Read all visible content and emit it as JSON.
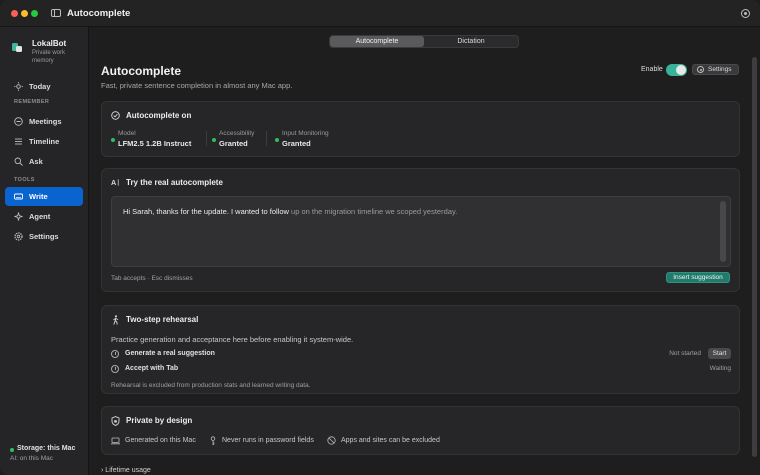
{
  "window": {
    "title": "Autocomplete"
  },
  "sidebar": {
    "brand_name": "LokalBot",
    "brand_tagline": "Private work memory",
    "section_remember": "REMEMBER",
    "section_tools": "TOOLS",
    "items": [
      {
        "label": "Today",
        "icon": "sun-icon"
      },
      {
        "label": "Meetings",
        "icon": "waveform-icon"
      },
      {
        "label": "Timeline",
        "icon": "list-icon"
      },
      {
        "label": "Ask",
        "icon": "magnifier-icon"
      },
      {
        "label": "Write",
        "icon": "keyboard-icon",
        "active": true
      },
      {
        "label": "Agent",
        "icon": "sparkle-icon"
      },
      {
        "label": "Settings",
        "icon": "gear-icon"
      }
    ],
    "storage_title": "Storage: this Mac",
    "storage_sub": "AI: on this Mac"
  },
  "tabs": [
    {
      "label": "Autocomplete",
      "active": true
    },
    {
      "label": "Dictation",
      "active": false
    }
  ],
  "header": {
    "title": "Autocomplete",
    "subtitle": "Fast, private sentence completion in almost any Mac app.",
    "enable_label": "Enable",
    "enabled": true,
    "settings_label": "Settings"
  },
  "status_card": {
    "title": "Autocomplete on",
    "items": [
      {
        "label": "Model",
        "value": "LFM2.5 1.2B Instruct"
      },
      {
        "label": "Accessibility",
        "value": "Granted"
      },
      {
        "label": "Input Monitoring",
        "value": "Granted"
      }
    ]
  },
  "try_card": {
    "title": "Try the real autocomplete",
    "typed_text": "Hi Sarah, thanks for the update. I wanted to follow",
    "ghost_text": " up on the migration timeline we scoped yesterday.",
    "hint": "Tab accepts · Esc dismisses",
    "insert_label": "Insert suggestion"
  },
  "rehearsal_card": {
    "title": "Two-step rehearsal",
    "description": "Practice generation and acceptance here before enabling it system-wide.",
    "steps": [
      {
        "label": "Generate a real suggestion",
        "status": "Not started",
        "action": "Start"
      },
      {
        "label": "Accept with Tab",
        "status": "Waiting"
      }
    ],
    "note": "Rehearsal is excluded from production stats and learned writing data."
  },
  "privacy_card": {
    "title": "Private by design",
    "items": [
      {
        "label": "Generated on this Mac",
        "icon": "laptop-icon"
      },
      {
        "label": "Never runs in password fields",
        "icon": "key-icon"
      },
      {
        "label": "Apps and sites can be excluded",
        "icon": "no-entry-icon"
      }
    ]
  },
  "footer": {
    "lifetime_label": "Lifetime usage"
  },
  "colors": {
    "accent": "#0a64d0",
    "toggle_on": "#39b29a",
    "insert_button": "#237a6a",
    "status_ok": "#2fbf5a"
  }
}
